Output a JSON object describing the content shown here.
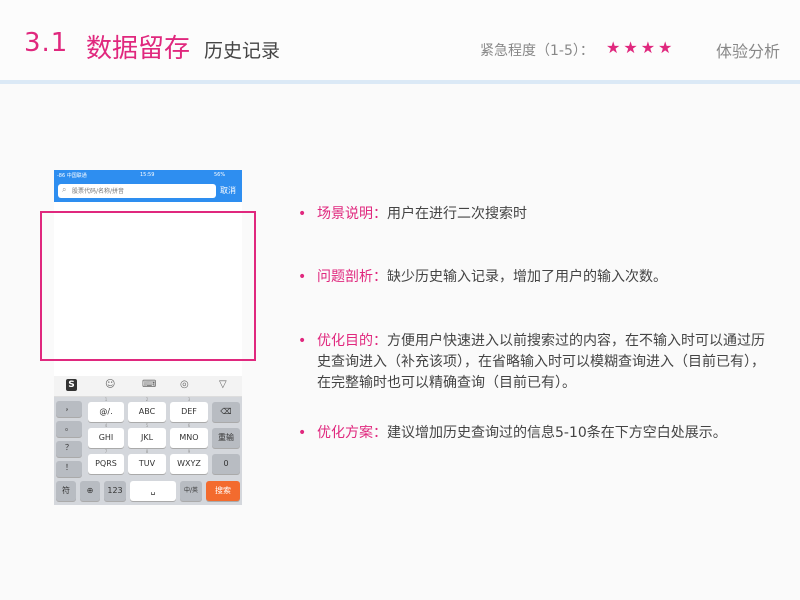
{
  "header": {
    "section_number": "3.1",
    "section_title": "数据留存",
    "subtitle": "历史记录",
    "urgency_label": "紧急程度（1-5）：",
    "urgency_stars": "★★★★",
    "urgency_level": 4,
    "tag": "体验分析",
    "accent_color": "#e0287e"
  },
  "phone": {
    "status_bar": {
      "carrier": "-86 中国联通",
      "time": "15:59",
      "battery": "56%"
    },
    "search_placeholder": "股票代码/名称/拼音",
    "cancel_label": "取消",
    "toolbar_icons": [
      "sogou-logo-icon",
      "emoji-icon",
      "keyboard-icon",
      "target-icon",
      "collapse-icon"
    ],
    "keyboard": {
      "side_keys": [
        "，",
        "。",
        "？",
        "！"
      ],
      "rows": [
        [
          {
            "label": "@/.",
            "hint": "1"
          },
          {
            "label": "ABC",
            "hint": "2"
          },
          {
            "label": "DEF",
            "hint": "3"
          }
        ],
        [
          {
            "label": "GHI",
            "hint": "4"
          },
          {
            "label": "JKL",
            "hint": "5"
          },
          {
            "label": "MNO",
            "hint": "6"
          }
        ],
        [
          {
            "label": "PQRS",
            "hint": "7"
          },
          {
            "label": "TUV",
            "hint": "8"
          },
          {
            "label": "WXYZ",
            "hint": "9"
          }
        ]
      ],
      "reenter_label": "重输",
      "zero_label": "0",
      "bottom": {
        "symbol": "符",
        "numbers": "123",
        "lang": "中/英",
        "search": "搜索"
      }
    }
  },
  "bullets": [
    {
      "label": "场景说明：",
      "text": "用户在进行二次搜索时"
    },
    {
      "label": "问题剖析：",
      "text": "缺少历史输入记录，增加了用户的输入次数。"
    },
    {
      "label": "优化目的：",
      "text": "方便用户快速进入以前搜索过的内容，在不输入时可以通过历史查询进入（补充该项），在省略输入时可以模糊查询进入（目前已有），在完整输时也可以精确查询（目前已有）。"
    },
    {
      "label": "优化方案：",
      "text": "建议增加历史查询过的信息5-10条在下方空白处展示。"
    }
  ]
}
